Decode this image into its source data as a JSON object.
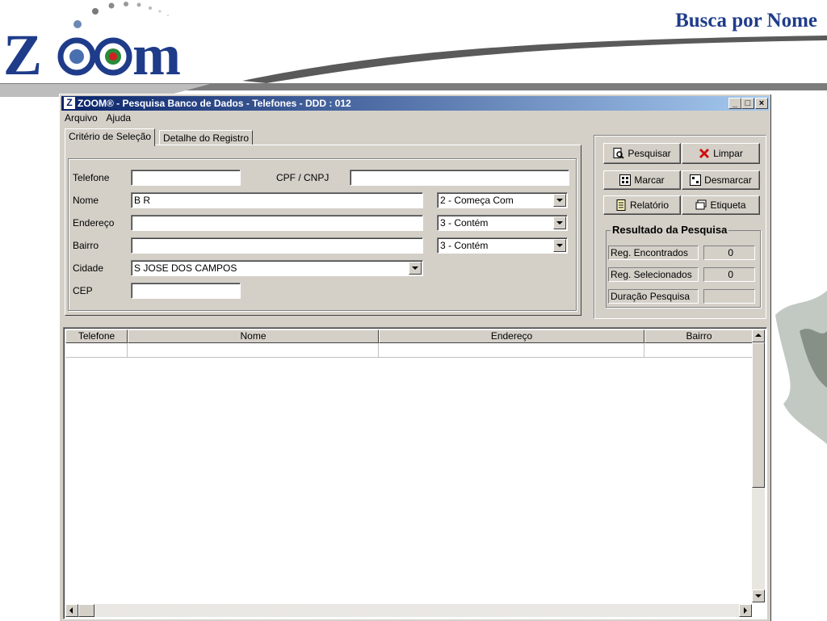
{
  "slide": {
    "title": "Busca por Nome",
    "logo_text": "Z  m"
  },
  "window": {
    "title": "ZOOM® - Pesquisa Banco de Dados - Telefones - DDD : 012",
    "app_icon_letter": "Z",
    "controls": {
      "minimize": "_",
      "maximize": "□",
      "close": "×"
    }
  },
  "menu": {
    "items": [
      "Arquivo",
      "Ajuda"
    ]
  },
  "tabs": {
    "selection": "Critério de Seleção",
    "detail": "Detalhe do Registro"
  },
  "form": {
    "telefone": {
      "label": "Telefone",
      "value": ""
    },
    "cpf": {
      "label": "CPF / CNPJ",
      "value": ""
    },
    "nome": {
      "label": "Nome",
      "value": "B R",
      "mode": "2 - Começa Com"
    },
    "endereco": {
      "label": "Endereço",
      "value": "",
      "mode": "3 - Contém"
    },
    "bairro": {
      "label": "Bairro",
      "value": "",
      "mode": "3 - Contém"
    },
    "cidade": {
      "label": "Cidade",
      "value": "S JOSE DOS CAMPOS"
    },
    "cep": {
      "label": "CEP",
      "value": ""
    }
  },
  "buttons": {
    "pesquisar": "Pesquisar",
    "limpar": "Limpar",
    "marcar": "Marcar",
    "desmarcar": "Desmarcar",
    "relatorio": "Relatório",
    "etiqueta": "Etiqueta"
  },
  "results": {
    "title": "Resultado da Pesquisa",
    "found_label": "Reg. Encontrados",
    "found_value": "0",
    "selected_label": "Reg. Selecionados",
    "selected_value": "0",
    "duration_label": "Duração Pesquisa",
    "duration_value": ""
  },
  "grid": {
    "columns": [
      "Telefone",
      "Nome",
      "Endereço",
      "Bairro"
    ]
  },
  "colors": {
    "title_blue": "#1f3c8a",
    "window_gray": "#d4d0c8",
    "titlebar_start": "#0a246a",
    "clear_red": "#d01010"
  }
}
